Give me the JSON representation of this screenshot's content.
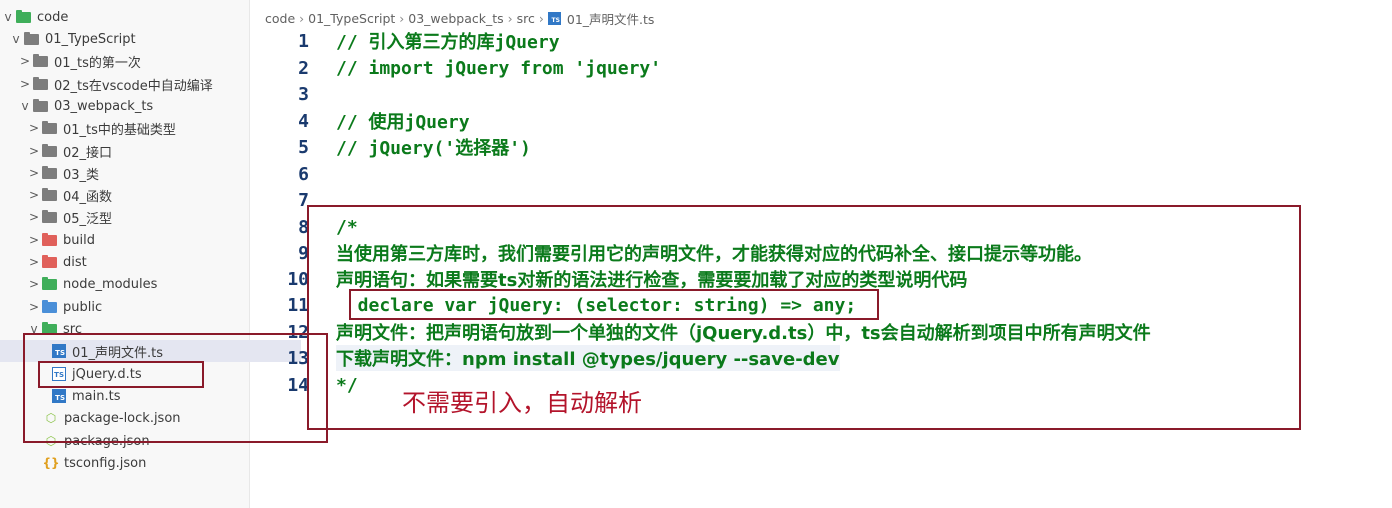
{
  "explorer": {
    "items": [
      {
        "label": "code",
        "chevron": "v",
        "icon": "folder-vscode-icon"
      },
      {
        "label": "01_TypeScript",
        "chevron": "v",
        "icon": "folder-open-icon"
      },
      {
        "label": "01_ts的第一次",
        "chevron": ">",
        "icon": "folder-icon"
      },
      {
        "label": "02_ts在vscode中自动编译",
        "chevron": ">",
        "icon": "folder-icon"
      },
      {
        "label": "03_webpack_ts",
        "chevron": "v",
        "icon": "folder-open-icon"
      },
      {
        "label": "01_ts中的基础类型",
        "chevron": ">",
        "icon": "folder-icon"
      },
      {
        "label": "02_接口",
        "chevron": ">",
        "icon": "folder-icon"
      },
      {
        "label": "03_类",
        "chevron": ">",
        "icon": "folder-icon"
      },
      {
        "label": "04_函数",
        "chevron": ">",
        "icon": "folder-icon"
      },
      {
        "label": "05_泛型",
        "chevron": ">",
        "icon": "folder-icon"
      },
      {
        "label": "build",
        "chevron": ">",
        "icon": "folder-build-icon"
      },
      {
        "label": "dist",
        "chevron": ">",
        "icon": "folder-dist-icon"
      },
      {
        "label": "node_modules",
        "chevron": ">",
        "icon": "folder-node-icon"
      },
      {
        "label": "public",
        "chevron": ">",
        "icon": "folder-public-icon"
      },
      {
        "label": "src",
        "chevron": "v",
        "icon": "folder-src-icon"
      },
      {
        "label": "01_声明文件.ts",
        "chevron": "",
        "icon": "typescript-file-icon"
      },
      {
        "label": "jQuery.d.ts",
        "chevron": "",
        "icon": "typescript-def-icon"
      },
      {
        "label": "main.ts",
        "chevron": "",
        "icon": "typescript-file-icon"
      },
      {
        "label": "package-lock.json",
        "chevron": "",
        "icon": "nodejs-json-icon"
      },
      {
        "label": "package.json",
        "chevron": "",
        "icon": "nodejs-json-icon"
      },
      {
        "label": "tsconfig.json",
        "chevron": "",
        "icon": "json-braces-icon"
      }
    ]
  },
  "breadcrumb": [
    "code",
    "01_TypeScript",
    "03_webpack_ts",
    "src",
    "01_声明文件.ts"
  ],
  "editor": {
    "lines": [
      {
        "num": "1",
        "text": "// 引入第三方的库jQuery"
      },
      {
        "num": "2",
        "text": "// import jQuery from 'jquery'"
      },
      {
        "num": "3",
        "text": ""
      },
      {
        "num": "4",
        "text": "// 使用jQuery"
      },
      {
        "num": "5",
        "text": "// jQuery('选择器')"
      },
      {
        "num": "6",
        "text": ""
      },
      {
        "num": "7",
        "text": ""
      },
      {
        "num": "8",
        "text": "/*"
      },
      {
        "num": "9",
        "text": "当使用第三方库时，我们需要引用它的声明文件，才能获得对应的代码补全、接口提示等功能。"
      },
      {
        "num": "10",
        "text": "声明语句：如果需要ts对新的语法进行检查，需要要加载了对应的类型说明代码"
      },
      {
        "num": "11",
        "text": "  declare var jQuery: (selector: string) => any;"
      },
      {
        "num": "12",
        "text": "声明文件：把声明语句放到一个单独的文件（jQuery.d.ts）中，ts会自动解析到项目中所有声明文件"
      },
      {
        "num": "13",
        "text": "下载声明文件：npm install @types/jquery --save-dev"
      },
      {
        "num": "14",
        "text": "*/"
      }
    ]
  },
  "annotation": {
    "text": "不需要引入，自动解析"
  },
  "colors": {
    "comment": "#0b7a1b",
    "line_number": "#1a3a6e",
    "annotation": "#b3142b",
    "box": "#8a1a2a"
  }
}
